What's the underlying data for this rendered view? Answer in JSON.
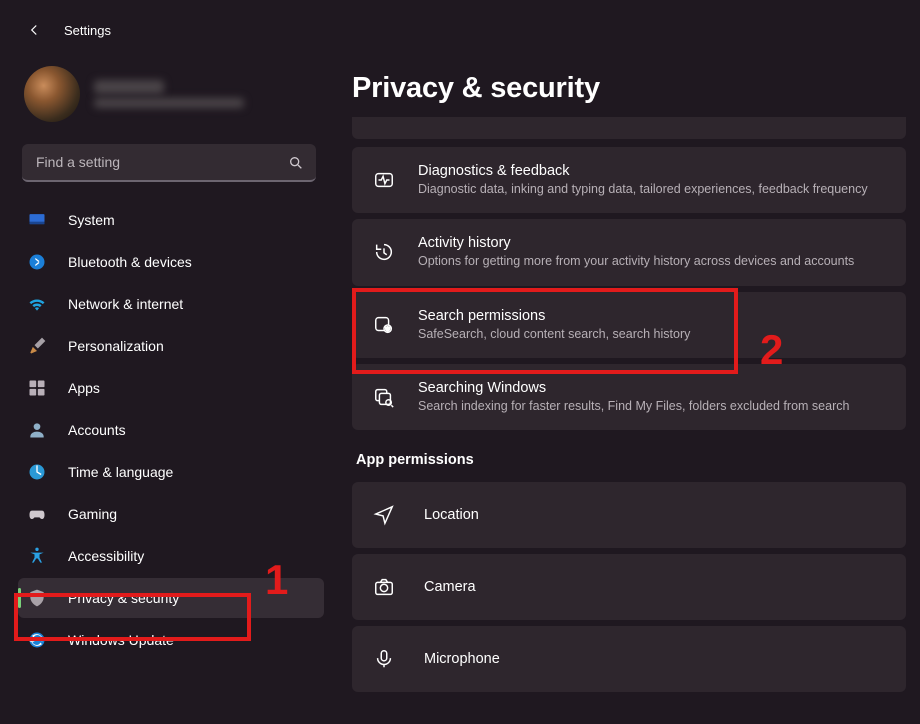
{
  "header": {
    "title": "Settings"
  },
  "search": {
    "placeholder": "Find a setting"
  },
  "sidebar": {
    "items": [
      {
        "label": "System"
      },
      {
        "label": "Bluetooth & devices"
      },
      {
        "label": "Network & internet"
      },
      {
        "label": "Personalization"
      },
      {
        "label": "Apps"
      },
      {
        "label": "Accounts"
      },
      {
        "label": "Time & language"
      },
      {
        "label": "Gaming"
      },
      {
        "label": "Accessibility"
      },
      {
        "label": "Privacy & security"
      },
      {
        "label": "Windows Update"
      }
    ]
  },
  "page": {
    "title": "Privacy & security"
  },
  "cards": [
    {
      "title": "Diagnostics & feedback",
      "desc": "Diagnostic data, inking and typing data, tailored experiences, feedback frequency"
    },
    {
      "title": "Activity history",
      "desc": "Options for getting more from your activity history across devices and accounts"
    },
    {
      "title": "Search permissions",
      "desc": "SafeSearch, cloud content search, search history"
    },
    {
      "title": "Searching Windows",
      "desc": "Search indexing for faster results, Find My Files, folders excluded from search"
    }
  ],
  "section": {
    "app_permissions": "App permissions"
  },
  "perms": [
    {
      "title": "Location"
    },
    {
      "title": "Camera"
    },
    {
      "title": "Microphone"
    }
  ],
  "annotations": {
    "num1": "1",
    "num2": "2"
  }
}
